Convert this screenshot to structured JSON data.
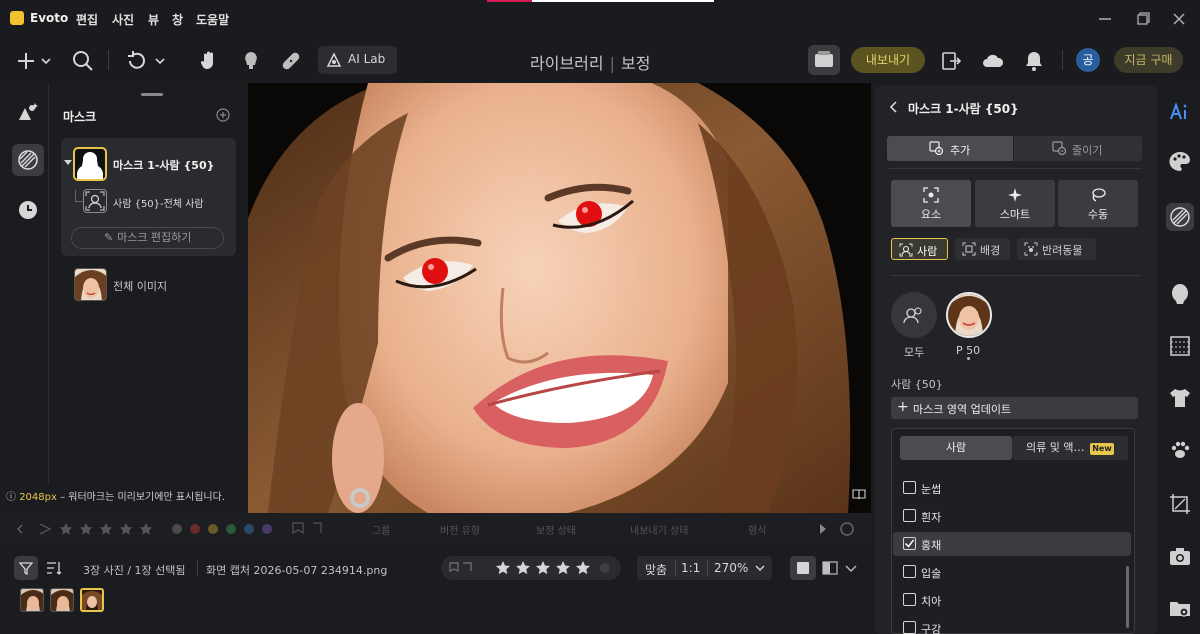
{
  "titlebar": {
    "app_name": "Evoto",
    "menu": [
      "편집",
      "사진",
      "뷰",
      "창",
      "도움말"
    ]
  },
  "toolbar": {
    "ai_lab_label": "AI Lab",
    "mode_library": "라이브러리",
    "mode_edit": "보정",
    "export_label": "내보내기",
    "avatar_initial": "공",
    "buy_label": "지금 구매"
  },
  "mask_panel": {
    "title": "마스크",
    "mask_name": "마스크 1-사람 {50}",
    "sub_item": "사람 {50}-전체 사람",
    "edit_mask_label": "마스크 편집하기",
    "full_image_label": "전체 이미지"
  },
  "notice": {
    "size": "2048",
    "size_unit": "px",
    "text": " – 워터마크는 미리보기에만 표시됩니다."
  },
  "filter_bar": {
    "labels": [
      "그룹",
      "버전 유형",
      "보정 상태",
      "내보내기 상태",
      "형식"
    ]
  },
  "bottom_bar": {
    "count_label": "3장 사진 / 1장 선택됨",
    "file_name": "화면 캡처 2026-05-07 234914.png",
    "fit_label": "맞춤",
    "one_to_one": "1:1",
    "zoom": "270%"
  },
  "right_panel": {
    "title": "마스크 1-사람 {50}",
    "tab_add": "추가",
    "tab_subtract": "줄이기",
    "modes": [
      "요소",
      "스마트",
      "수동"
    ],
    "categories": [
      "사람",
      "배경",
      "반려동물"
    ],
    "people": [
      {
        "label": "모두"
      },
      {
        "label": "P 50"
      }
    ],
    "selection_label": "사람 {50}",
    "update_label": "마스크 영역 업데이트"
  },
  "dropdown": {
    "tab_person": "사람",
    "tab_clothing": "의류 및 액…",
    "new_badge": "New",
    "items": [
      {
        "label": "눈썹",
        "checked": false
      },
      {
        "label": "흰자",
        "checked": false
      },
      {
        "label": "홍채",
        "checked": true
      },
      {
        "label": "입술",
        "checked": false
      },
      {
        "label": "치아",
        "checked": false
      },
      {
        "label": "구강",
        "checked": false
      }
    ]
  },
  "colors": {
    "accent_yellow": "#e8c54a",
    "accent_pink": "#d21a55",
    "panel_bg": "#222327",
    "red_eye": "#e01010"
  }
}
